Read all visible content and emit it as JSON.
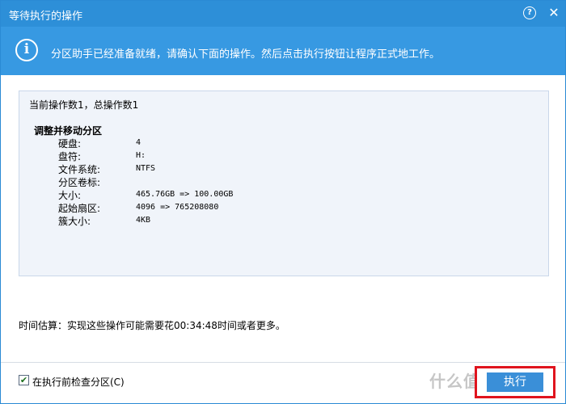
{
  "window": {
    "title": "等待执行的操作",
    "help_glyph": "?",
    "close_glyph": "✕"
  },
  "banner": {
    "icon_glyph": "i",
    "message": "分区助手已经准备就绪，请确认下面的操作。然后点击执行按钮让程序正式地工作。"
  },
  "operations": {
    "summary": "当前操作数1，总操作数1",
    "title": "调整并移动分区",
    "properties": [
      {
        "label": "硬盘:",
        "value": "4"
      },
      {
        "label": "盘符:",
        "value": "H:"
      },
      {
        "label": "文件系统:",
        "value": "NTFS"
      },
      {
        "label": "分区卷标:",
        "value": ""
      },
      {
        "label": "大小:",
        "value": "465.76GB => 100.00GB"
      },
      {
        "label": "起始扇区:",
        "value": "4096 => 765208080"
      },
      {
        "label": "簇大小:",
        "value": "4KB"
      }
    ]
  },
  "estimate": "时间估算：实现这些操作可能需要花00:34:48时间或者更多。",
  "footer": {
    "check_before_label": "在执行前检查分区(C)",
    "check_before_checked": true,
    "check_mark": "✔",
    "watermark": "什么值得买",
    "execute_label": "执行"
  },
  "colors": {
    "titlebar": "#2d8fd8",
    "banner": "#3799e2",
    "panel": "#f0f4fa",
    "highlight_box": "#e0141e"
  }
}
